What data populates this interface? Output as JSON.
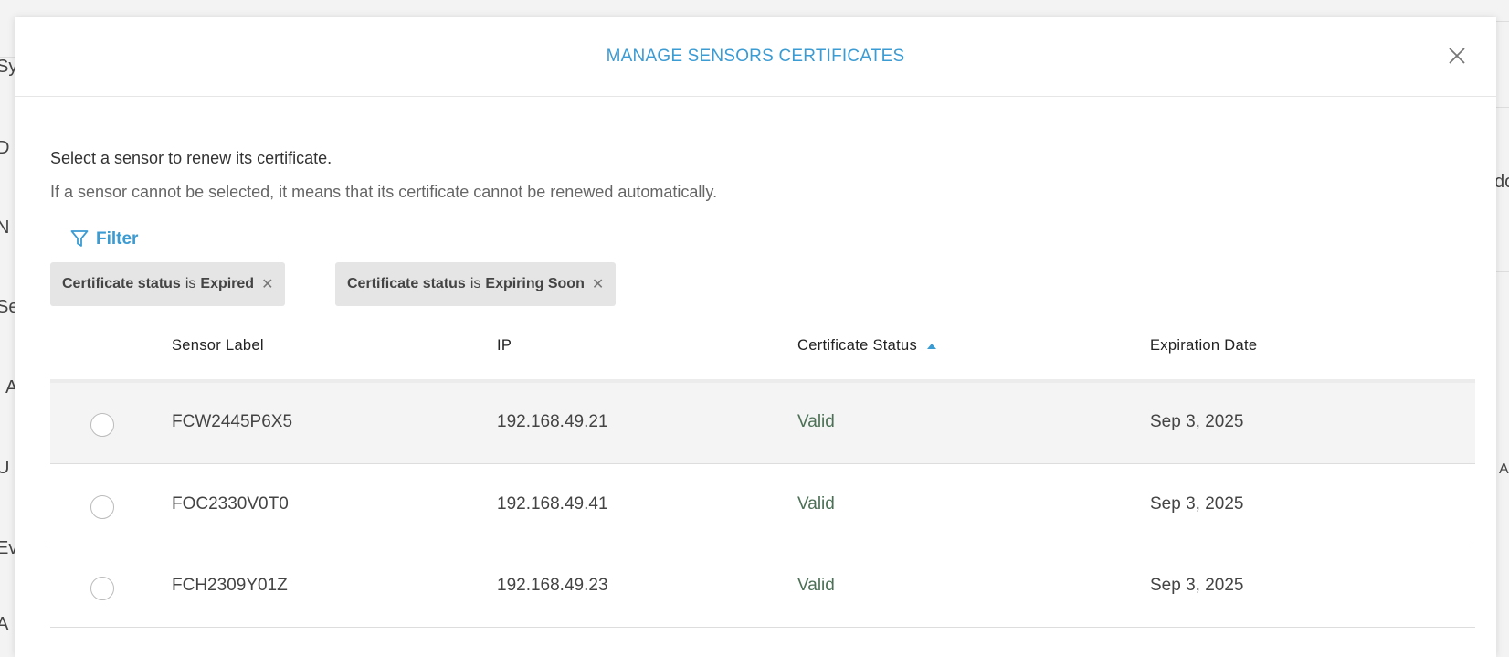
{
  "background": {
    "left_letters": [
      "Sy",
      "D",
      "N",
      "Se",
      "A",
      "U",
      "Ev",
      "A"
    ],
    "right_letters": [
      "do",
      "A"
    ]
  },
  "modal": {
    "title": "MANAGE SENSORS CERTIFICATES",
    "lead": "Select a sensor to renew its certificate.",
    "subtitle": "If a sensor cannot be selected, it means that its certificate cannot be renewed automatically.",
    "filter_label": "Filter",
    "chips": [
      {
        "field": "Certificate status",
        "op": "is",
        "value": "Expired"
      },
      {
        "field": "Certificate status",
        "op": "is",
        "value": "Expiring Soon"
      }
    ],
    "columns": [
      "Sensor Label",
      "IP",
      "Certificate Status",
      "Expiration Date"
    ],
    "rows": [
      {
        "label": "FCW2445P6X5",
        "ip": "192.168.49.21",
        "status": "Valid",
        "expires": "Sep 3, 2025"
      },
      {
        "label": "FOC2330V0T0",
        "ip": "192.168.49.41",
        "status": "Valid",
        "expires": "Sep 3, 2025"
      },
      {
        "label": "FCH2309Y01Z",
        "ip": "192.168.49.23",
        "status": "Valid",
        "expires": "Sep 3, 2025"
      }
    ]
  },
  "colors": {
    "accent": "#3b9bd3",
    "valid": "#4b7055"
  }
}
